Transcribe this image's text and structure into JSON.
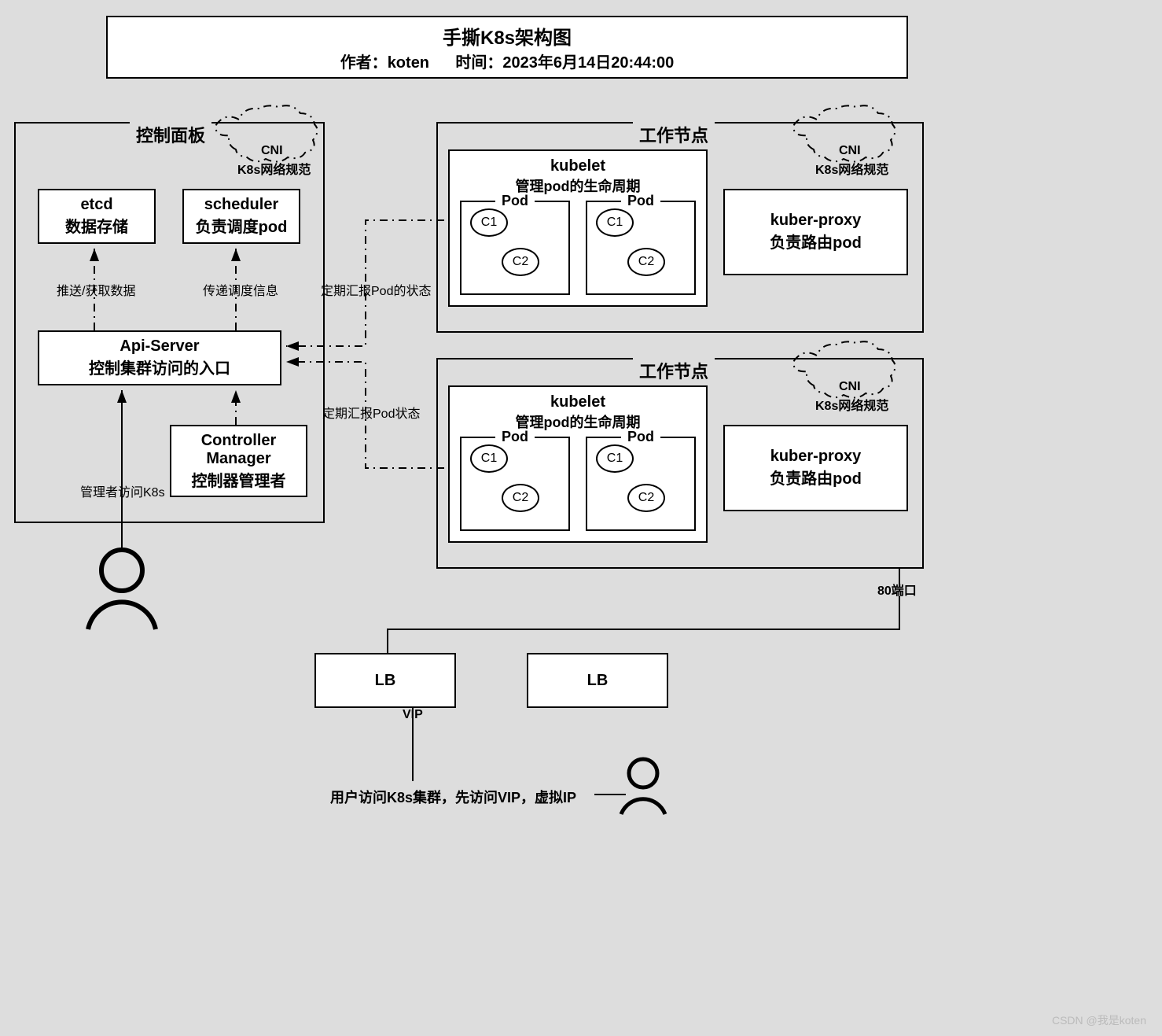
{
  "header": {
    "title": "手撕K8s架构图",
    "author_label": "作者：",
    "author": "koten",
    "time_label": "时间：",
    "time": "2023年6月14日20:44:00"
  },
  "control_panel": {
    "title": "控制面板",
    "cni_line1": "CNI",
    "cni_line2": "K8s网络规范",
    "etcd_line1": "etcd",
    "etcd_line2": "数据存储",
    "scheduler_line1": "scheduler",
    "scheduler_line2": "负责调度pod",
    "api_server_line1": "Api-Server",
    "api_server_line2": "控制集群访问的入口",
    "controller_line1": "Controller",
    "controller_line2": "Manager",
    "controller_line3": "控制器管理者",
    "arrow_etcd": "推送/获取数据",
    "arrow_scheduler": "传递调度信息",
    "arrow_admin": "管理者访问K8s"
  },
  "worker": {
    "title": "工作节点",
    "cni_line1": "CNI",
    "cni_line2": "K8s网络规范",
    "kubelet_line1": "kubelet",
    "kubelet_line2": "管理pod的生命周期",
    "pod_title": "Pod",
    "c1": "C1",
    "c2": "C2",
    "kubeproxy_line1": "kuber-proxy",
    "kubeproxy_line2": "负责路由pod"
  },
  "connectors": {
    "report1": "定期汇报Pod的状态",
    "report2": "定期汇报Pod状态",
    "port80": "80端口",
    "vip": "VIP",
    "user_access": "用户访问K8s集群，先访问VIP，虚拟IP"
  },
  "lb": {
    "label": "LB"
  },
  "watermark": "CSDN @我是koten"
}
